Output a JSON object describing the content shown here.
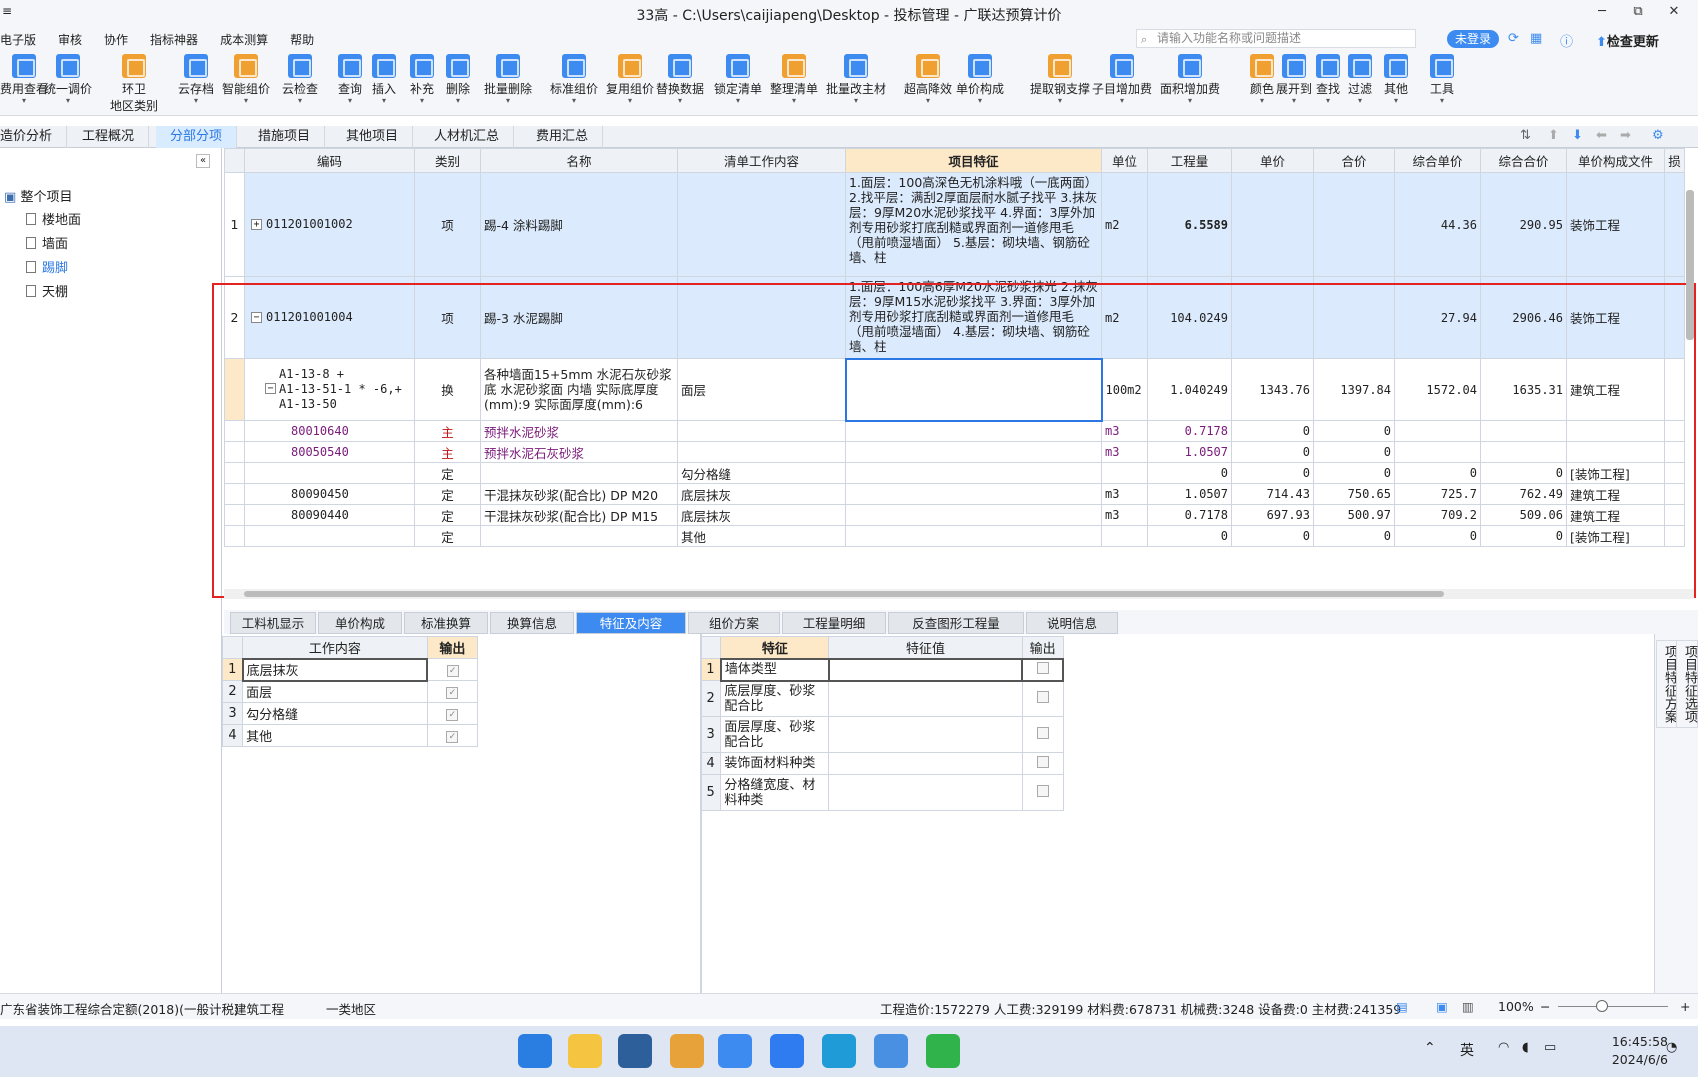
{
  "window": {
    "title": "33高 - C:\\Users\\caijiapeng\\Desktop - 投标管理 - 广联达预算计价",
    "min": "─",
    "max": "▢",
    "close": "✕",
    "restore": "⧉"
  },
  "menu": {
    "items": [
      "电子版",
      "审核",
      "协作",
      "指标神器",
      "成本测算",
      "帮助"
    ],
    "search_placeholder": "请输入功能名称或问题描述",
    "login": "未登录",
    "update": "检查更新"
  },
  "toolbar": {
    "buttons": [
      {
        "label": "费用查看",
        "color": "#3d8bf0"
      },
      {
        "label": "统一调价",
        "color": "#3d8bf0"
      },
      {
        "label": "环卫",
        "sub": "地区类别",
        "color": "#f0a030"
      },
      {
        "label": "云存档",
        "color": "#3d8bf0"
      },
      {
        "label": "智能组价",
        "color": "#f0a030"
      },
      {
        "label": "云检查",
        "color": "#3d8bf0"
      },
      {
        "label": "查询",
        "color": "#3d8bf0"
      },
      {
        "label": "插入",
        "color": "#3d8bf0"
      },
      {
        "label": "补充",
        "color": "#3d8bf0"
      },
      {
        "label": "删除",
        "color": "#3d8bf0"
      },
      {
        "label": "批量删除",
        "color": "#3d8bf0"
      },
      {
        "label": "标准组价",
        "color": "#3d8bf0"
      },
      {
        "label": "复用组价",
        "color": "#f0a030"
      },
      {
        "label": "替换数据",
        "color": "#3d8bf0"
      },
      {
        "label": "锁定清单",
        "color": "#3d8bf0"
      },
      {
        "label": "整理清单",
        "color": "#f0a030"
      },
      {
        "label": "批量改主材",
        "color": "#3d8bf0"
      },
      {
        "label": "超高降效",
        "color": "#f0a030"
      },
      {
        "label": "单价构成",
        "color": "#3d8bf0"
      },
      {
        "label": "提取钢支撑",
        "color": "#f0a030"
      },
      {
        "label": "子目增加费",
        "color": "#3d8bf0"
      },
      {
        "label": "面积增加费",
        "color": "#3d8bf0"
      },
      {
        "label": "颜色",
        "color": "#f0a030"
      },
      {
        "label": "展开到",
        "color": "#3d8bf0"
      },
      {
        "label": "查找",
        "color": "#3d8bf0"
      },
      {
        "label": "过滤",
        "color": "#3d8bf0"
      },
      {
        "label": "其他",
        "color": "#3d8bf0"
      },
      {
        "label": "工具",
        "color": "#3d8bf0"
      }
    ]
  },
  "main_tabs": [
    "造价分析",
    "工程概况",
    "分部分项",
    "措施项目",
    "其他项目",
    "人材机汇总",
    "费用汇总"
  ],
  "tree": {
    "collapse": "«",
    "root": "整个项目",
    "children": [
      "楼地面",
      "墙面",
      "踢脚",
      "天棚"
    ]
  },
  "grid": {
    "headers": [
      "编码",
      "类别",
      "名称",
      "清单工作内容",
      "项目特征",
      "单位",
      "工程量",
      "单价",
      "合价",
      "综合单价",
      "综合合价",
      "单价构成文件",
      "损"
    ],
    "rows": [
      {
        "no": "1",
        "exp": "+",
        "code": "011201001002",
        "type": "项",
        "name": "踢-4 涂料踢脚",
        "work": "",
        "feature": "1.面层：100高深色无机涂料哦（一底两面）\n2.找平层：满刮2厚面层耐水腻子找平\n3.抹灰层：9厚M20水泥砂浆找平\n4.界面：3厚外加剂专用砂浆打底刮糙或界面剂一道修甩毛（甩前喷湿墙面）\n5.基层：砌块墙、钢筋砼墙、柱",
        "unit": "m2",
        "qty": "6.5589",
        "price": "",
        "total": "",
        "comp_price": "44.36",
        "comp_total": "290.95",
        "file": "装饰工程"
      },
      {
        "no": "2",
        "exp": "−",
        "code": "011201001004",
        "type": "项",
        "name": "踢-3 水泥踢脚",
        "work": "",
        "feature": "1.面层：100高6厚M20水泥砂浆抹光\n2.抹灰层：9厚M15水泥砂浆找平\n3.界面：3厚外加剂专用砂浆打底刮糙或界面剂一道修甩毛（甩前喷湿墙面）\n4.基层：砌块墙、钢筋砼墙、柱",
        "unit": "m2",
        "qty": "104.0249",
        "price": "",
        "total": "",
        "comp_price": "27.94",
        "comp_total": "2906.46",
        "file": "装饰工程"
      },
      {
        "no": "",
        "exp": "−",
        "code": "A1-13-8 +\nA1-13-51-1 * -6,+\nA1-13-50",
        "type": "换",
        "name": "各种墙面15+5mm 水泥石灰砂浆底 水泥砂浆面 内墙  实际底厚度(mm):9  实际面厚度(mm):6",
        "work": "面层",
        "feature": "",
        "unit": "100m2",
        "qty": "1.040249",
        "price": "1343.76",
        "total": "1397.84",
        "comp_price": "1572.04",
        "comp_total": "1635.31",
        "file": "建筑工程"
      },
      {
        "no": "",
        "code": "80010640",
        "type": "主",
        "name": "预拌水泥砂浆",
        "work": "",
        "feature": "",
        "unit": "m3",
        "qty": "0.7178",
        "price": "0",
        "total": "0",
        "comp_price": "",
        "comp_total": "",
        "file": ""
      },
      {
        "no": "",
        "code": "80050540",
        "type": "主",
        "name": "预拌水泥石灰砂浆",
        "work": "",
        "feature": "",
        "unit": "m3",
        "qty": "1.0507",
        "price": "0",
        "total": "0",
        "comp_price": "",
        "comp_total": "",
        "file": ""
      },
      {
        "no": "",
        "code": "",
        "type": "定",
        "name": "",
        "work": "勾分格缝",
        "feature": "",
        "unit": "",
        "qty": "0",
        "price": "0",
        "total": "0",
        "comp_price": "0",
        "comp_total": "0",
        "file": "[装饰工程]"
      },
      {
        "no": "",
        "code": "80090450",
        "type": "定",
        "name": "干混抹灰砂浆(配合比) DP M20",
        "work": "底层抹灰",
        "feature": "",
        "unit": "m3",
        "qty": "1.0507",
        "price": "714.43",
        "total": "750.65",
        "comp_price": "725.7",
        "comp_total": "762.49",
        "file": "建筑工程"
      },
      {
        "no": "",
        "code": "80090440",
        "type": "定",
        "name": "干混抹灰砂浆(配合比) DP M15",
        "work": "底层抹灰",
        "feature": "",
        "unit": "m3",
        "qty": "0.7178",
        "price": "697.93",
        "total": "500.97",
        "comp_price": "709.2",
        "comp_total": "509.06",
        "file": "建筑工程"
      },
      {
        "no": "",
        "code": "",
        "type": "定",
        "name": "",
        "work": "其他",
        "feature": "",
        "unit": "",
        "qty": "0",
        "price": "0",
        "total": "0",
        "comp_price": "0",
        "comp_total": "0",
        "file": "[装饰工程]"
      }
    ]
  },
  "bottom_tabs": [
    "工料机显示",
    "单价构成",
    "标准换算",
    "换算信息",
    "特征及内容",
    "组价方案",
    "工程量明细",
    "反查图形工程量",
    "说明信息"
  ],
  "work_table": {
    "headers": [
      "工作内容",
      "输出"
    ],
    "rows": [
      {
        "no": "1",
        "text": "底层抹灰",
        "checked": "✓"
      },
      {
        "no": "2",
        "text": "面层",
        "checked": "✓"
      },
      {
        "no": "3",
        "text": "勾分格缝",
        "checked": "✓"
      },
      {
        "no": "4",
        "text": "其他",
        "checked": "✓"
      }
    ]
  },
  "feature_table": {
    "headers": [
      "特征",
      "特征值",
      "输出"
    ],
    "rows": [
      {
        "no": "1",
        "text": "墙体类型"
      },
      {
        "no": "2",
        "text": "底层厚度、砂浆配合比"
      },
      {
        "no": "3",
        "text": "面层厚度、砂浆配合比"
      },
      {
        "no": "4",
        "text": "装饰面材料种类"
      },
      {
        "no": "5",
        "text": "分格缝宽度、材料种类"
      }
    ]
  },
  "side_tabs": [
    "项目特征方案",
    "项目特征选项"
  ],
  "status": {
    "quota": "广东省装饰工程综合定额(2018)(一般计税)",
    "engineering": "建筑工程",
    "region": "一类地区",
    "summary": "工程造价:1572279  人工费:329199  材料费:678731  机械费:3248  设备费:0  主材费:241359",
    "zoom": "100%"
  },
  "taskbar": {
    "ime": "英",
    "time": "16:45:58",
    "date": "2024/6/6",
    "apps": [
      {
        "name": "start",
        "color": "#2a7de1"
      },
      {
        "name": "explorer",
        "color": "#f5c542"
      },
      {
        "name": "cad",
        "color": "#2d5f9a"
      },
      {
        "name": "help",
        "color": "#e8a23a"
      },
      {
        "name": "glodon",
        "color": "#3d8bf0"
      },
      {
        "name": "feishu",
        "color": "#2f7bf0"
      },
      {
        "name": "edge",
        "color": "#1f9bd8"
      },
      {
        "name": "notes",
        "color": "#4a90e2"
      },
      {
        "name": "wechat",
        "color": "#2fb34a"
      }
    ]
  }
}
